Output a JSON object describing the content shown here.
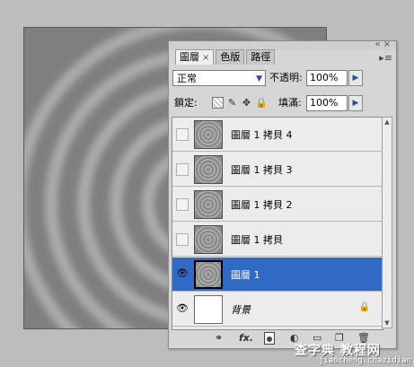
{
  "panel": {
    "tabs": [
      {
        "label": "圖層",
        "close": "×"
      },
      {
        "label": "色版"
      },
      {
        "label": "路徑"
      }
    ],
    "blend_mode": "正常",
    "opacity_label": "不透明:",
    "opacity_value": "100%",
    "lock_label": "鎖定:",
    "fill_label": "填滿:",
    "fill_value": "100%",
    "menu_icon": "▸≡",
    "titlebar_controls": "«  ×"
  },
  "layers": [
    {
      "name": "圖層 1 拷貝 4",
      "visible": false,
      "selected": false
    },
    {
      "name": "圖層 1 拷貝 3",
      "visible": false,
      "selected": false
    },
    {
      "name": "圖層 1 拷貝 2",
      "visible": false,
      "selected": false
    },
    {
      "name": "圖層 1 拷貝",
      "visible": false,
      "selected": false
    },
    {
      "name": "圖層 1",
      "visible": true,
      "selected": true
    },
    {
      "name": "背景",
      "visible": true,
      "selected": false,
      "locked": true
    }
  ],
  "watermark": {
    "text": "查字典 教程网",
    "url": "jiaocheng.chazidian.com"
  },
  "colors": {
    "selection": "#316ac5",
    "canvas": "#7f7f7f",
    "ring": "#a9a9a9"
  }
}
